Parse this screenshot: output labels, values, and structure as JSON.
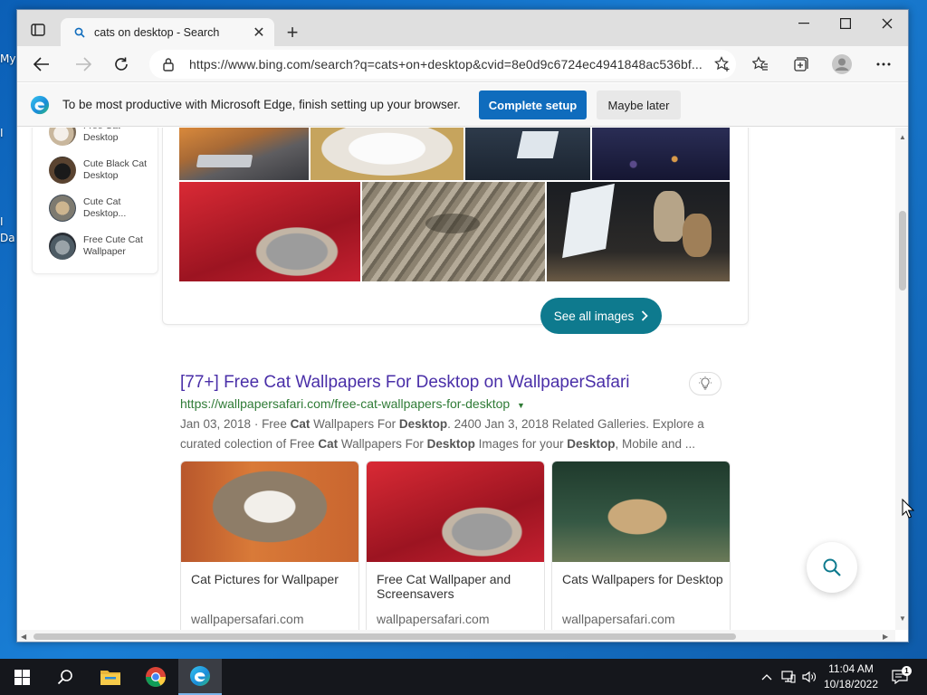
{
  "desktop": {
    "frag_top": "My",
    "frag_mid": "I",
    "frag_low": "I",
    "frag_bottom": "Da"
  },
  "browser": {
    "tab_title": "cats on desktop - Search",
    "url": "https://www.bing.com/search?q=cats+on+desktop&cvid=8e0d9c6724ec4941848ac536bf..."
  },
  "infobar": {
    "message": "To be most productive with Microsoft Edge, finish setting up your browser.",
    "primary_label": "Complete setup",
    "secondary_label": "Maybe later"
  },
  "related": [
    {
      "label": "Free Cat Desktop"
    },
    {
      "label": "Cute Black Cat Desktop"
    },
    {
      "label": "Cute Cat Desktop..."
    },
    {
      "label": "Free Cute Cat Wallpaper"
    }
  ],
  "images": {
    "see_all_label": "See all images"
  },
  "result": {
    "title": "[77+] Free Cat Wallpapers For Desktop on WallpaperSafari",
    "url": "https://wallpapersafari.com/free-cat-wallpapers-for-desktop",
    "snippet": {
      "p1": "Jan 03, 2018 · Free ",
      "b1": "Cat",
      "p2": " Wallpapers For ",
      "b2": "Desktop",
      "p3": ". 2400 Jan 3, 2018 Related Galleries. Explore a curated colection of Free ",
      "b3": "Cat",
      "p4": " Wallpapers For ",
      "b4": "Desktop",
      "p5": " Images for your ",
      "b5": "Desktop",
      "p6": ", Mobile and ..."
    },
    "tiles": [
      {
        "caption": "Cat Pictures for Wallpaper",
        "domain": "wallpapersafari.com"
      },
      {
        "caption": "Free Cat Wallpaper and Screensavers",
        "domain": "wallpapersafari.com"
      },
      {
        "caption": "Cats Wallpapers for Desktop",
        "domain": "wallpapersafari.com"
      }
    ]
  },
  "taskbar": {
    "time": "11:04 AM",
    "date": "10/18/2022"
  },
  "colors": {
    "accent": "#0f6cbd",
    "see_all": "#0e7a8e",
    "result_title": "#4a2fa8",
    "result_url": "#2f7b36"
  }
}
